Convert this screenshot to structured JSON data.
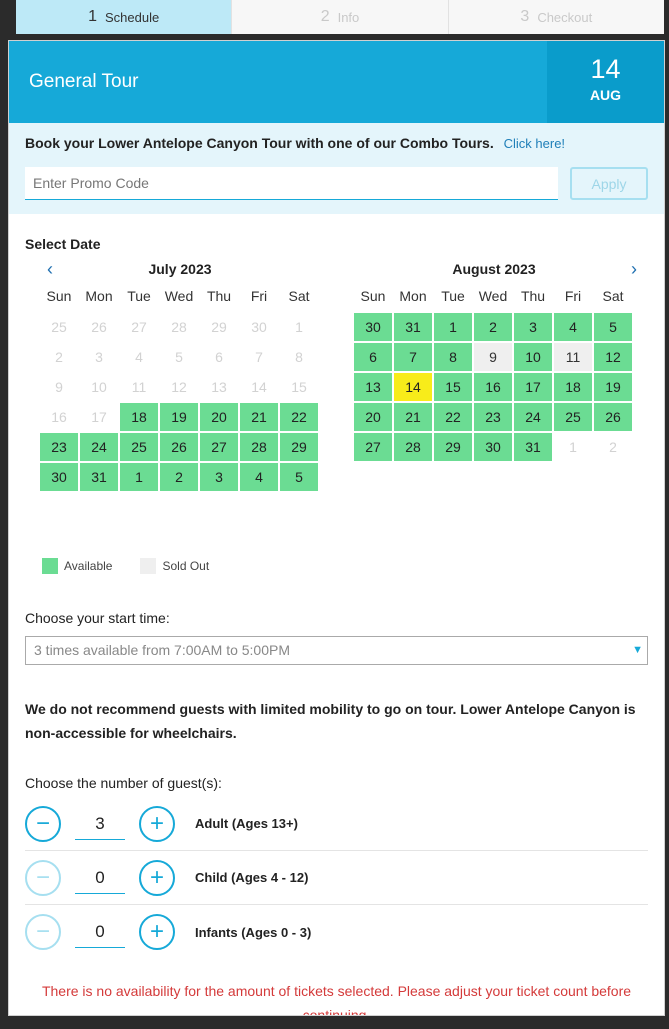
{
  "stepper": [
    {
      "num": "1",
      "label": "Schedule"
    },
    {
      "num": "2",
      "label": "Info"
    },
    {
      "num": "3",
      "label": "Checkout"
    }
  ],
  "header": {
    "title": "General Tour",
    "day": "14",
    "month": "AUG"
  },
  "promo": {
    "combo_text": "Book your Lower Antelope Canyon Tour with one of our Combo Tours.",
    "combo_link": "Click here!",
    "placeholder": "Enter Promo Code",
    "apply_label": "Apply"
  },
  "select_date_label": "Select Date",
  "weekdays": [
    "Sun",
    "Mon",
    "Tue",
    "Wed",
    "Thu",
    "Fri",
    "Sat"
  ],
  "nav": {
    "prev": "‹",
    "next": "›"
  },
  "calendars": [
    {
      "title": "July 2023",
      "weeks": [
        [
          [
            "25",
            "past"
          ],
          [
            "26",
            "past"
          ],
          [
            "27",
            "past"
          ],
          [
            "28",
            "past"
          ],
          [
            "29",
            "past"
          ],
          [
            "30",
            "past"
          ],
          [
            "1",
            "past"
          ]
        ],
        [
          [
            "2",
            "past"
          ],
          [
            "3",
            "past"
          ],
          [
            "4",
            "past"
          ],
          [
            "5",
            "past"
          ],
          [
            "6",
            "past"
          ],
          [
            "7",
            "past"
          ],
          [
            "8",
            "past"
          ]
        ],
        [
          [
            "9",
            "past"
          ],
          [
            "10",
            "past"
          ],
          [
            "11",
            "past"
          ],
          [
            "12",
            "past"
          ],
          [
            "13",
            "past"
          ],
          [
            "14",
            "past"
          ],
          [
            "15",
            "past"
          ]
        ],
        [
          [
            "16",
            "past"
          ],
          [
            "17",
            "past"
          ],
          [
            "18",
            "avail"
          ],
          [
            "19",
            "avail"
          ],
          [
            "20",
            "avail"
          ],
          [
            "21",
            "avail"
          ],
          [
            "22",
            "avail"
          ]
        ],
        [
          [
            "23",
            "avail"
          ],
          [
            "24",
            "avail"
          ],
          [
            "25",
            "avail"
          ],
          [
            "26",
            "avail"
          ],
          [
            "27",
            "avail"
          ],
          [
            "28",
            "avail"
          ],
          [
            "29",
            "avail"
          ]
        ],
        [
          [
            "30",
            "avail"
          ],
          [
            "31",
            "avail"
          ],
          [
            "1",
            "avail"
          ],
          [
            "2",
            "avail"
          ],
          [
            "3",
            "avail"
          ],
          [
            "4",
            "avail"
          ],
          [
            "5",
            "avail"
          ]
        ]
      ]
    },
    {
      "title": "August 2023",
      "weeks": [
        [
          [
            "30",
            "avail"
          ],
          [
            "31",
            "avail"
          ],
          [
            "1",
            "avail"
          ],
          [
            "2",
            "avail"
          ],
          [
            "3",
            "avail"
          ],
          [
            "4",
            "avail"
          ],
          [
            "5",
            "avail"
          ]
        ],
        [
          [
            "6",
            "avail"
          ],
          [
            "7",
            "avail"
          ],
          [
            "8",
            "avail"
          ],
          [
            "9",
            "sold"
          ],
          [
            "10",
            "avail"
          ],
          [
            "11",
            "sold"
          ],
          [
            "12",
            "avail"
          ]
        ],
        [
          [
            "13",
            "avail"
          ],
          [
            "14",
            "selected"
          ],
          [
            "15",
            "avail"
          ],
          [
            "16",
            "avail"
          ],
          [
            "17",
            "avail"
          ],
          [
            "18",
            "avail"
          ],
          [
            "19",
            "avail"
          ]
        ],
        [
          [
            "20",
            "avail"
          ],
          [
            "21",
            "avail"
          ],
          [
            "22",
            "avail"
          ],
          [
            "23",
            "avail"
          ],
          [
            "24",
            "avail"
          ],
          [
            "25",
            "avail"
          ],
          [
            "26",
            "avail"
          ]
        ],
        [
          [
            "27",
            "avail"
          ],
          [
            "28",
            "avail"
          ],
          [
            "29",
            "avail"
          ],
          [
            "30",
            "avail"
          ],
          [
            "31",
            "avail"
          ],
          [
            "1",
            "past"
          ],
          [
            "2",
            "past"
          ]
        ]
      ]
    }
  ],
  "legend": {
    "available": "Available",
    "sold_out": "Sold Out"
  },
  "start_time": {
    "label": "Choose your start time:",
    "value": "3 times available from 7:00AM to 5:00PM"
  },
  "notice": "We do not recommend guests with limited mobility to go on tour. Lower Antelope Canyon is non-accessible for wheelchairs.",
  "guests": {
    "label": "Choose the number of guest(s):",
    "rows": [
      {
        "qty": "3",
        "label": "Adult (Ages 13+)"
      },
      {
        "qty": "0",
        "label": "Child (Ages 4 - 12)"
      },
      {
        "qty": "0",
        "label": "Infants (Ages 0 - 3)"
      }
    ]
  },
  "error": "There is no availability for the amount of tickets selected. Please adjust your ticket count before continuing.",
  "colors": {
    "accent": "#16a9d8",
    "available": "#6bdc93",
    "selected": "#f8ec1a",
    "error": "#d43a3a"
  }
}
